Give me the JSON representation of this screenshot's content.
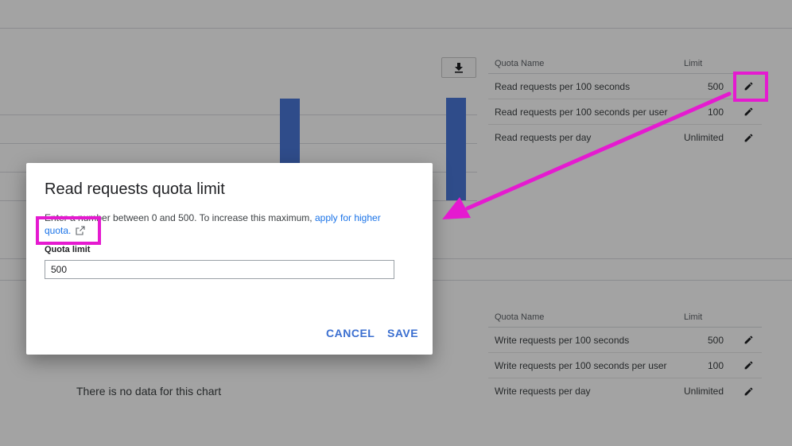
{
  "chart_top": {
    "empty_message": ""
  },
  "chart_bottom": {
    "empty_message": "There is no data for this chart"
  },
  "read_quota_table": {
    "headers": {
      "name": "Quota Name",
      "limit": "Limit"
    },
    "rows": [
      {
        "name": "Read requests per 100 seconds",
        "limit": "500",
        "edit_icon": "pencil-icon"
      },
      {
        "name": "Read requests per 100 seconds per user",
        "limit": "100",
        "edit_icon": "pencil-icon"
      },
      {
        "name": "Read requests per day",
        "limit": "Unlimited",
        "edit_icon": "pencil-icon"
      }
    ]
  },
  "write_quota_table": {
    "headers": {
      "name": "Quota Name",
      "limit": "Limit"
    },
    "rows": [
      {
        "name": "Write requests per 100 seconds",
        "limit": "500",
        "edit_icon": "pencil-icon"
      },
      {
        "name": "Write requests per 100 seconds per user",
        "limit": "100",
        "edit_icon": "pencil-icon"
      },
      {
        "name": "Write requests per day",
        "limit": "Unlimited",
        "edit_icon": "pencil-icon"
      }
    ]
  },
  "dialog": {
    "title": "Read requests quota limit",
    "description": "Enter a number between 0 and 500. To increase this maximum, ",
    "link_text_1": "apply for higher",
    "link_text_2": "quota.",
    "field_label": "Quota limit",
    "field_value": "500",
    "cancel_label": "CANCEL",
    "save_label": "SAVE"
  },
  "colors": {
    "accent": "#1a73e8",
    "bar": "#4a78d8",
    "annotation": "#e51ad0"
  }
}
